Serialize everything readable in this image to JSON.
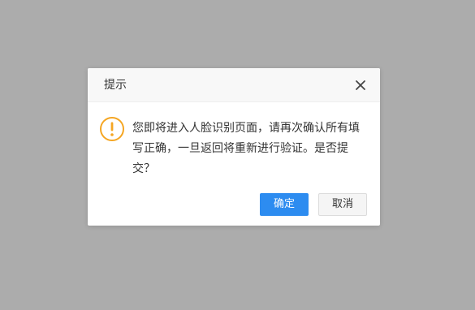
{
  "dialog": {
    "title": "提示",
    "message": "您即将进入人脸识别页面，请再次确认所有填写正确，一旦返回将重新进行验证。是否提交？",
    "confirm_label": "确定",
    "cancel_label": "取消",
    "icons": {
      "close": "close-icon",
      "warning": "warning-icon"
    },
    "colors": {
      "overlay": "#acacac",
      "primary": "#2d8cf0",
      "warning": "#f5a623"
    }
  }
}
